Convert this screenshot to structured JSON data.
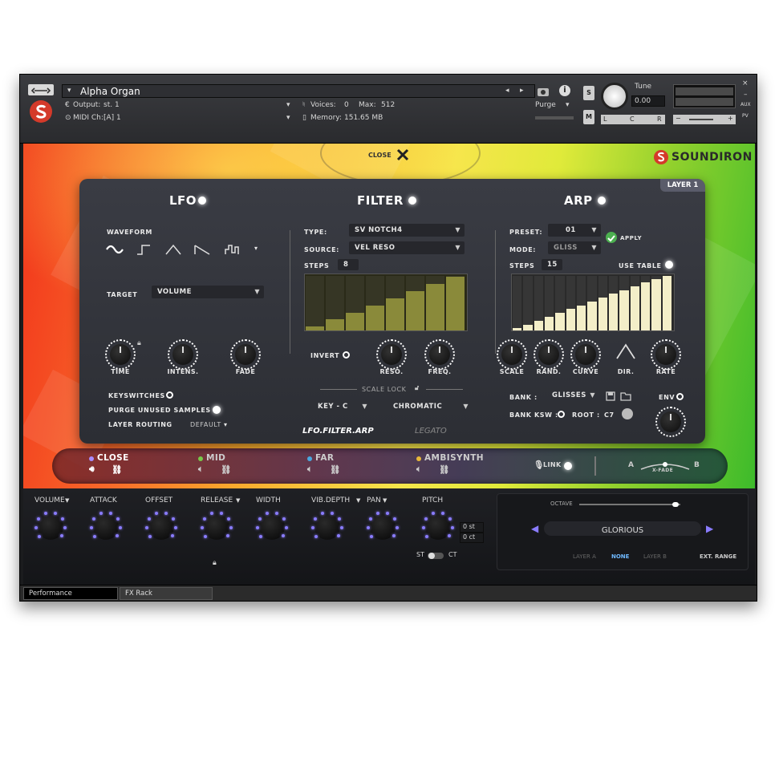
{
  "header": {
    "instrument_name": "Alpha Organ",
    "output_label": "Output:",
    "output_value": "st. 1",
    "midi_label": "MIDI Ch:",
    "midi_value": "[A]  1",
    "voices_label": "Voices:",
    "voices_value": "0",
    "max_label": "Max:",
    "max_value": "512",
    "memory_label": "Memory:",
    "memory_value": "151.65 MB",
    "purge_label": "Purge",
    "s_button": "S",
    "m_button": "M",
    "tune_label": "Tune",
    "tune_value": "0.00",
    "pan_l": "L",
    "pan_c": "C",
    "pan_r": "R",
    "aux_label": "AUX",
    "pv_label": "PV",
    "vol_minus": "−",
    "vol_plus": "+"
  },
  "brand": {
    "logo_text": "SOUNDIRON",
    "close_label": "CLOSE",
    "layer_badge": "LAYER 1"
  },
  "lfo": {
    "title": "LFO",
    "waveform_label": "WAVEFORM",
    "target_label": "TARGET",
    "target_value": "VOLUME",
    "knobs": [
      {
        "label": "TIME"
      },
      {
        "label": "INTENS."
      },
      {
        "label": "FADE"
      }
    ],
    "keyswitches_label": "KEYSWITCHES",
    "purge_label": "PURGE UNUSED SAMPLES",
    "routing_label": "LAYER ROUTING",
    "routing_value": "DEFAULT"
  },
  "filter": {
    "title": "FILTER",
    "type_label": "TYPE:",
    "type_value": "SV NOTCH4",
    "source_label": "SOURCE:",
    "source_value": "VEL RESO",
    "steps_label": "STEPS",
    "steps_value": "8",
    "steps": [
      0.08,
      0.2,
      0.33,
      0.46,
      0.59,
      0.72,
      0.85,
      0.98
    ],
    "invert_label": "INVERT",
    "knobs": [
      {
        "label": "RESO."
      },
      {
        "label": "FREQ."
      }
    ],
    "scale_lock_label": "SCALE LOCK",
    "key_value": "KEY - C",
    "scale_value": "CHROMATIC"
  },
  "arp": {
    "title": "ARP",
    "preset_label": "PRESET:",
    "preset_value": "01",
    "apply_label": "APPLY",
    "mode_label": "MODE:",
    "mode_value": "GLISS",
    "steps_label": "STEPS",
    "steps_value": "15",
    "use_table_label": "USE TABLE",
    "steps": [
      0.05,
      0.11,
      0.18,
      0.25,
      0.32,
      0.39,
      0.46,
      0.53,
      0.6,
      0.67,
      0.74,
      0.81,
      0.88,
      0.94,
      1.0
    ],
    "knobs": [
      {
        "label": "SCALE"
      },
      {
        "label": "RAND."
      },
      {
        "label": "CURVE"
      },
      {
        "label": "DIR."
      },
      {
        "label": "RATE"
      }
    ],
    "bank_label": "BANK :",
    "bank_value": "GLISSES",
    "bank_ksw_label": "BANK KSW :",
    "root_label": "ROOT :",
    "root_value": "C7",
    "env_label": "ENV"
  },
  "nav": {
    "tab1": "LFO.FILTER.ARP",
    "tab2": "LEGATO"
  },
  "layers": [
    {
      "name": "CLOSE",
      "color": "#a98cff"
    },
    {
      "name": "MID",
      "color": "#77c94a"
    },
    {
      "name": "FAR",
      "color": "#4aa8e0"
    },
    {
      "name": "AMBISYNTH",
      "color": "#e8b83a"
    }
  ],
  "link_label": "LINK",
  "xfade": {
    "a": "A",
    "b": "B",
    "label": "X-FADE"
  },
  "bottom": {
    "knobs": [
      {
        "label": "VOLUME",
        "dd": true
      },
      {
        "label": "ATTACK"
      },
      {
        "label": "OFFSET"
      },
      {
        "label": "RELEASE",
        "dd": true
      },
      {
        "label": "WIDTH"
      },
      {
        "label": "VIB.DEPTH",
        "dd": true
      },
      {
        "label": "PAN",
        "dd": true
      },
      {
        "label": "PITCH"
      }
    ],
    "pitch_st": "0 st",
    "pitch_ct": "0 ct",
    "st_label": "ST",
    "ct_label": "CT",
    "octave_label": "OCTAVE",
    "preset_name": "GLORIOUS",
    "layer_a": "LAYER A",
    "none": "NONE",
    "layer_b": "LAYER B",
    "ext_range": "EXT. RANGE"
  },
  "tabs": {
    "performance": "Performance",
    "fx_rack": "FX Rack"
  }
}
